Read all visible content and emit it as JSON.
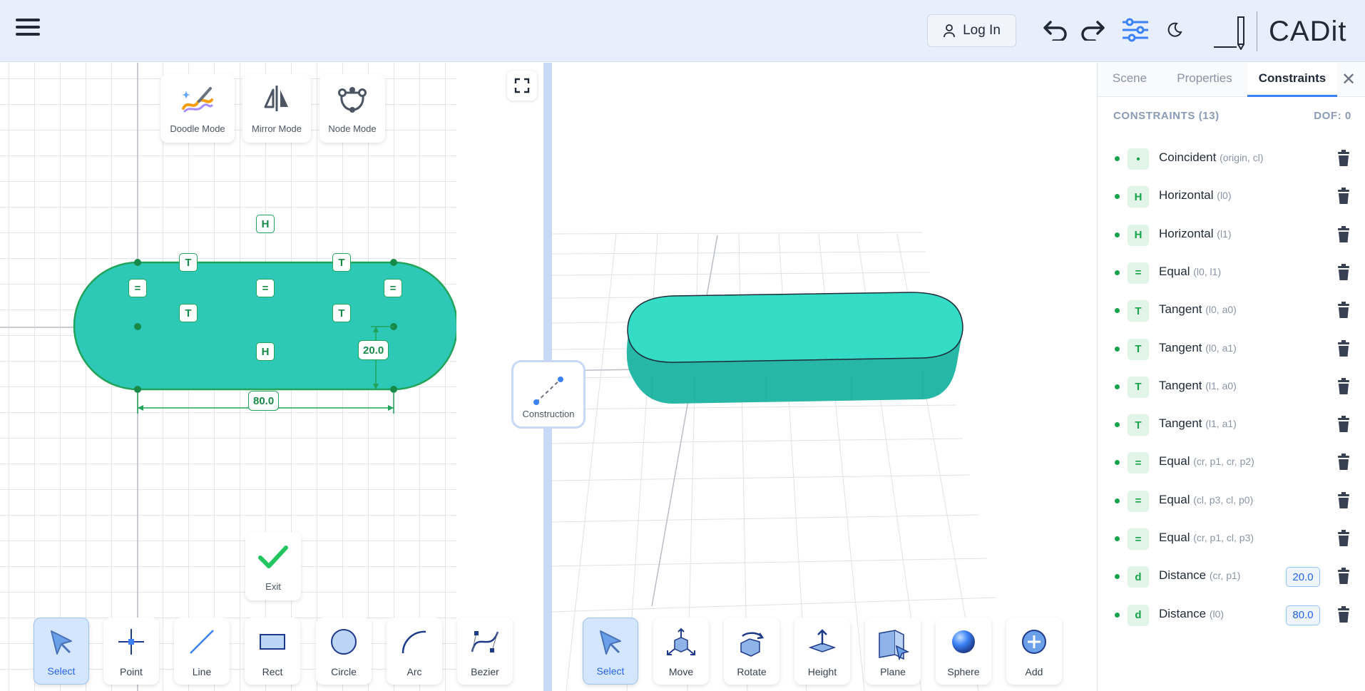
{
  "app": {
    "name": "CADit"
  },
  "header": {
    "login_label": "Log In"
  },
  "sketch": {
    "modes": [
      {
        "label": "Doodle Mode"
      },
      {
        "label": "Mirror Mode"
      },
      {
        "label": "Node Mode"
      }
    ],
    "dimensions": {
      "width": "80.0",
      "height": "20.0"
    },
    "exit_label": "Exit",
    "construction_label": "Construction",
    "tools": [
      {
        "label": "Select",
        "active": true
      },
      {
        "label": "Point"
      },
      {
        "label": "Line"
      },
      {
        "label": "Rect"
      },
      {
        "label": "Circle"
      },
      {
        "label": "Arc"
      },
      {
        "label": "Bezier"
      }
    ]
  },
  "view3d": {
    "tools": [
      {
        "label": "Select",
        "active": true
      },
      {
        "label": "Move"
      },
      {
        "label": "Rotate"
      },
      {
        "label": "Height"
      },
      {
        "label": "Plane"
      },
      {
        "label": "Sphere"
      },
      {
        "label": "Add"
      }
    ]
  },
  "panel": {
    "tabs": [
      {
        "label": "Scene"
      },
      {
        "label": "Properties"
      },
      {
        "label": "Constraints",
        "active": true
      }
    ],
    "close": "✕",
    "heading": "CONSTRAINTS (13)",
    "dof": "DOF: 0",
    "constraints": [
      {
        "badge": "•",
        "name": "Coincident",
        "args": "(origin, cl)"
      },
      {
        "badge": "H",
        "name": "Horizontal",
        "args": "(l0)"
      },
      {
        "badge": "H",
        "name": "Horizontal",
        "args": "(l1)"
      },
      {
        "badge": "=",
        "name": "Equal",
        "args": "(l0, l1)"
      },
      {
        "badge": "T",
        "name": "Tangent",
        "args": "(l0, a0)"
      },
      {
        "badge": "T",
        "name": "Tangent",
        "args": "(l0, a1)"
      },
      {
        "badge": "T",
        "name": "Tangent",
        "args": "(l1, a0)"
      },
      {
        "badge": "T",
        "name": "Tangent",
        "args": "(l1, a1)"
      },
      {
        "badge": "=",
        "name": "Equal",
        "args": "(cr, p1, cr, p2)"
      },
      {
        "badge": "=",
        "name": "Equal",
        "args": "(cl, p3, cl, p0)"
      },
      {
        "badge": "=",
        "name": "Equal",
        "args": "(cr, p1, cl, p3)"
      },
      {
        "badge": "d",
        "name": "Distance",
        "args": "(cr, p1)",
        "value": "20.0"
      },
      {
        "badge": "d",
        "name": "Distance",
        "args": "(l0)",
        "value": "80.0"
      }
    ]
  },
  "colors": {
    "accent": "#3b82f6",
    "shape": "#2ec9b6",
    "constraint": "#16a34a"
  }
}
